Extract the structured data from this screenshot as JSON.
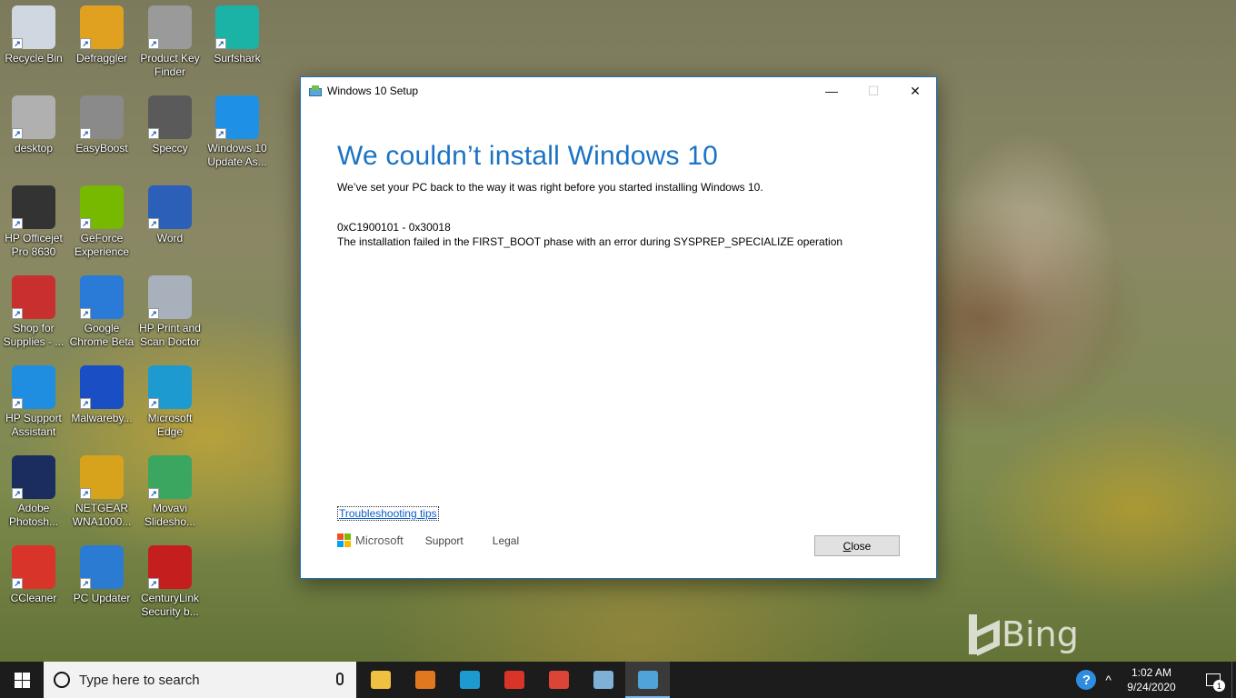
{
  "desktop": {
    "icons": [
      {
        "label": "Recycle Bin",
        "icon": "recycle-bin-icon",
        "color": "#cfd8e0"
      },
      {
        "label": "Defraggler",
        "icon": "defraggler-icon",
        "color": "#e0a020"
      },
      {
        "label": "Product Key Finder",
        "icon": "product-key-finder-icon",
        "color": "#9a9a9a"
      },
      {
        "label": "Surfshark",
        "icon": "surfshark-icon",
        "color": "#1bb3a6"
      },
      {
        "label": "desktop",
        "icon": "desktop-file-icon",
        "color": "#b0b0b0"
      },
      {
        "label": "EasyBoost",
        "icon": "easyboost-icon",
        "color": "#8a8a8a"
      },
      {
        "label": "Speccy",
        "icon": "speccy-icon",
        "color": "#5a5a5a"
      },
      {
        "label": "Windows 10 Update As...",
        "icon": "windows-update-icon",
        "color": "#1e90e6"
      },
      {
        "label": "HP Officejet Pro 8630",
        "icon": "printer-icon",
        "color": "#333333"
      },
      {
        "label": "GeForce Experience",
        "icon": "geforce-icon",
        "color": "#76b900"
      },
      {
        "label": "Word",
        "icon": "word-icon",
        "color": "#2b5fb8"
      },
      {
        "label": "Shop for Supplies - ...",
        "icon": "shop-supplies-icon",
        "color": "#c83030"
      },
      {
        "label": "Google Chrome Beta",
        "icon": "chrome-beta-icon",
        "color": "#2a7bd8"
      },
      {
        "label": "HP Print and Scan Doctor",
        "icon": "hp-doctor-icon",
        "color": "#a8b0bb"
      },
      {
        "label": "HP Support Assistant",
        "icon": "hp-support-icon",
        "color": "#1f8ee0"
      },
      {
        "label": "Malwareby...",
        "icon": "malwarebytes-icon",
        "color": "#1a4ec4"
      },
      {
        "label": "Microsoft Edge",
        "icon": "edge-icon",
        "color": "#1d9bd1"
      },
      {
        "label": "Adobe Photosh...",
        "icon": "photoshop-icon",
        "color": "#1b2d5f"
      },
      {
        "label": "NETGEAR WNA1000...",
        "icon": "netgear-icon",
        "color": "#d7a21c"
      },
      {
        "label": "Movavi Slidesho...",
        "icon": "movavi-icon",
        "color": "#3aa660"
      },
      {
        "label": "CCleaner",
        "icon": "ccleaner-icon",
        "color": "#d8342a"
      },
      {
        "label": "PC Updater",
        "icon": "pc-updater-icon",
        "color": "#2b7bd3"
      },
      {
        "label": "CenturyLink Security b...",
        "icon": "mcafee-icon",
        "color": "#c41e1e"
      }
    ]
  },
  "setup_window": {
    "title": "Windows 10 Setup",
    "controls": {
      "minimize": "—",
      "maximize": "☐",
      "close": "✕"
    },
    "heading": "We couldn’t install Windows 10",
    "subtext": "We’ve set your PC back to the way it was right before you started installing Windows 10.",
    "error_code": "0xC1900101 - 0x30018",
    "error_description": "The installation failed in the FIRST_BOOT phase with an error during SYSPREP_SPECIALIZE operation",
    "troubleshooting_link": "Troubleshooting tips",
    "footer": {
      "brand": "Microsoft",
      "support": "Support",
      "legal": "Legal"
    },
    "close_button": {
      "accel": "C",
      "rest": "lose"
    }
  },
  "watermark": {
    "text": "Bing"
  },
  "taskbar": {
    "search_placeholder": "Type here to search",
    "apps": [
      {
        "name": "file-explorer",
        "icon": "folder-icon",
        "color": "#f0c040"
      },
      {
        "name": "media-player",
        "icon": "media-player-icon",
        "color": "#e07820"
      },
      {
        "name": "microsoft-edge",
        "icon": "edge-icon",
        "color": "#1d9bd1"
      },
      {
        "name": "ccleaner",
        "icon": "ccleaner-icon",
        "color": "#d8342a"
      },
      {
        "name": "chrome",
        "icon": "chrome-icon",
        "color": "#db4437"
      },
      {
        "name": "snipping",
        "icon": "photo-app-icon",
        "color": "#7fb0d8"
      },
      {
        "name": "windows-10-setup",
        "icon": "windows-setup-icon",
        "color": "#4fa3d8"
      }
    ],
    "active_app": "windows-10-setup",
    "tray": {
      "help": "?",
      "chevron": "^",
      "time": "1:02 AM",
      "date": "9/24/2020",
      "notification_count": "1"
    }
  }
}
